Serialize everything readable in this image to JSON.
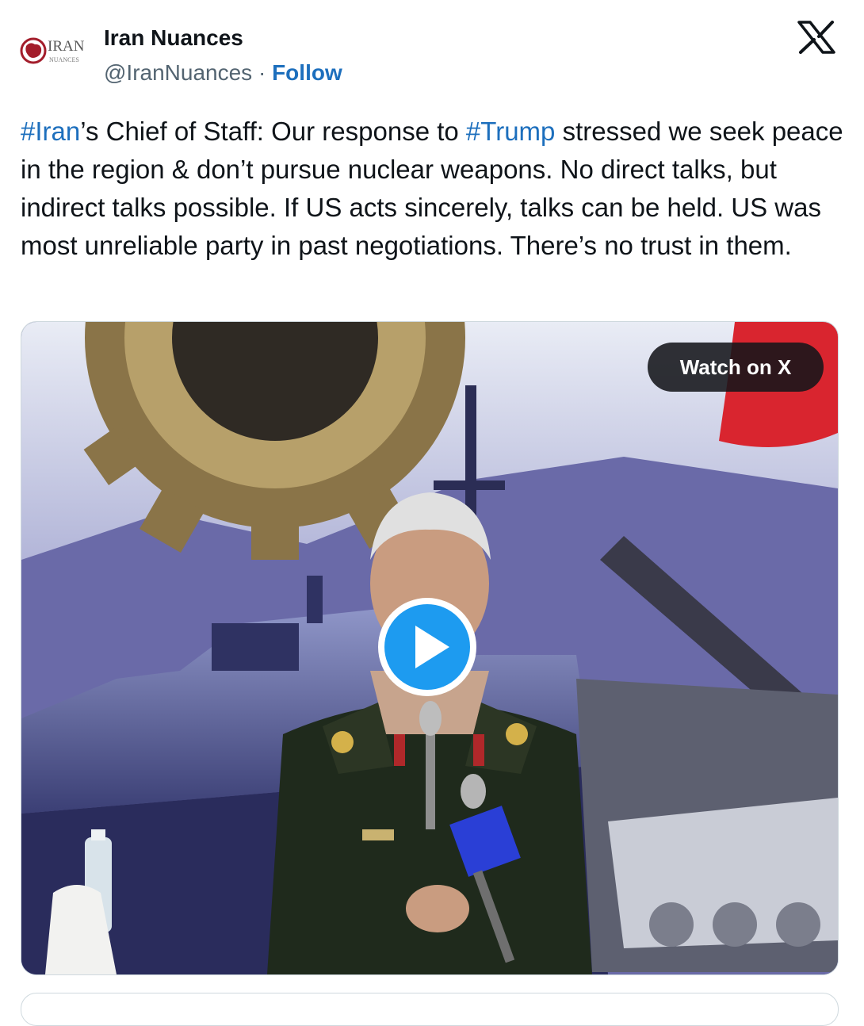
{
  "author": {
    "display_name": "Iran Nuances",
    "handle": "@IranNuances",
    "separator": "·",
    "follow_label": "Follow",
    "avatar_logo_text": "IRAN",
    "avatar_logo_subtext": "NUANCES"
  },
  "platform": {
    "logo_icon": "x-logo-icon"
  },
  "tweet": {
    "segments": [
      {
        "text": "#Iran",
        "type": "hashtag"
      },
      {
        "text": "’s Chief of Staff: Our response to ",
        "type": "text"
      },
      {
        "text": "#Trump",
        "type": "hashtag"
      },
      {
        "text": " stressed we seek peace in the region & don’t pursue nuclear weapons. No direct talks, but indirect talks possible. If US acts sincerely, talks can be held. US was most unreliable party in past negotiations. There’s no trust in them.",
        "type": "text"
      }
    ]
  },
  "media": {
    "watch_label": "Watch on X",
    "play_icon": "play-icon"
  },
  "colors": {
    "link": "#1d6fbd",
    "text": "#0f1419",
    "muted": "#536471",
    "play": "#1d9bf0"
  }
}
